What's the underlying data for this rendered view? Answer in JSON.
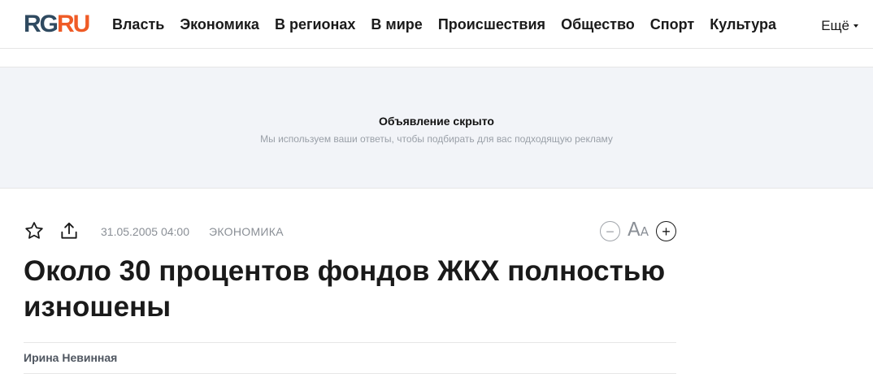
{
  "header": {
    "logo_left": "RG",
    "logo_right": "RU",
    "nav": [
      "Власть",
      "Экономика",
      "В регионах",
      "В мире",
      "Происшествия",
      "Общество",
      "Спорт",
      "Культура"
    ],
    "more_label": "Ещё"
  },
  "ad": {
    "title": "Объявление скрыто",
    "text": "Мы используем ваши ответы, чтобы подбирать для вас подходящую рекламу"
  },
  "article": {
    "date": "31.05.2005 04:00",
    "rubric": "ЭКОНОМИКА",
    "font_label_big": "А",
    "font_label_small": "А",
    "headline": "Около 30 процентов фондов ЖКХ полностью изношены",
    "author": "Ирина Невинная"
  },
  "icons": {
    "favorite": "star-icon",
    "share": "share-icon",
    "font_minus": "minus-circle-icon",
    "font_plus": "plus-circle-icon"
  },
  "colors": {
    "logo_dark": "#2f4a60",
    "logo_accent": "#ef5b26",
    "ad_background": "#f2f4f8",
    "meta_grey": "#8a8f96"
  }
}
